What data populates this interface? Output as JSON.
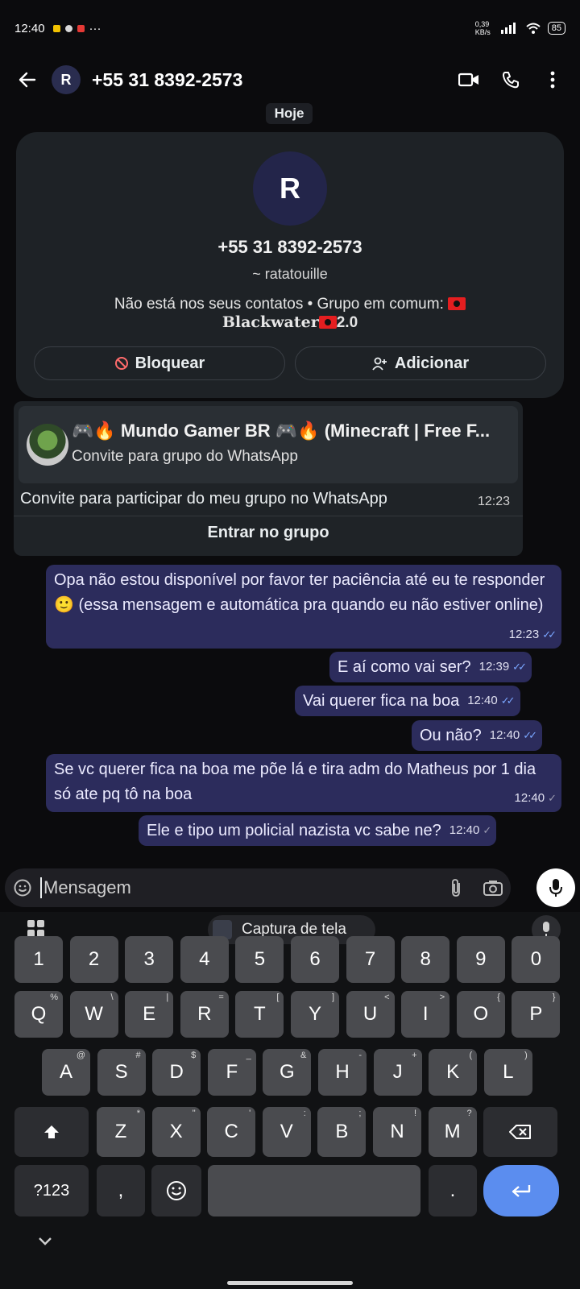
{
  "status": {
    "time": "12:40",
    "net_speed": "0,39 KB/s",
    "battery": "85"
  },
  "header": {
    "avatar_letter": "R",
    "title": "+55 31 8392-2573"
  },
  "chat": {
    "date_chip": "Hoje",
    "contact_card": {
      "avatar_letter": "R",
      "phone": "+55 31 8392-2573",
      "name": "~ ratatouille",
      "info_prefix": "Não está nos seus contatos  •  Grupo em comum: ",
      "group_name_a": "Blackwater",
      "group_name_b": "2.0",
      "block_label": "Bloquear",
      "add_label": "Adicionar"
    },
    "invite": {
      "title": "🎮🔥 Mundo Gamer BR 🎮🔥 (Minecraft | Free F...",
      "subtitle": "Convite para grupo do WhatsApp",
      "text": "Convite para participar do meu grupo no WhatsApp",
      "time": "12:23",
      "join_label": "Entrar no grupo"
    },
    "messages": [
      {
        "text": "Opa não estou disponível por favor ter paciência até eu te responder 🙂 (essa mensagem e automática pra quando eu não estiver online)",
        "time": "12:23",
        "status": "read"
      },
      {
        "text": "E aí como vai ser?",
        "time": "12:39",
        "status": "read"
      },
      {
        "text": "Vai querer fica na boa",
        "time": "12:40",
        "status": "read"
      },
      {
        "text": "Ou não?",
        "time": "12:40",
        "status": "read"
      },
      {
        "text": "Se vc querer fica na boa me põe lá e tira adm do Matheus por 1 dia só ate pq tô na boa",
        "time": "12:40",
        "status": "sent"
      },
      {
        "text": "Ele e tipo um policial nazista vc sabe ne?",
        "time": "12:40",
        "status": "sent"
      }
    ]
  },
  "input": {
    "placeholder": "Mensagem"
  },
  "keyboard": {
    "clipboard_label": "Captura de tela",
    "row_numbers": [
      "1",
      "2",
      "3",
      "4",
      "5",
      "6",
      "7",
      "8",
      "9",
      "0"
    ],
    "row1": [
      "Q",
      "W",
      "E",
      "R",
      "T",
      "Y",
      "U",
      "I",
      "O",
      "P"
    ],
    "row1_sup": [
      "%",
      "\\",
      "|",
      "=",
      "[",
      "]",
      "<",
      ">",
      "{",
      "}"
    ],
    "row2": [
      "A",
      "S",
      "D",
      "F",
      "G",
      "H",
      "J",
      "K",
      "L"
    ],
    "row2_sup": [
      "@",
      "#",
      "$",
      "_",
      "&",
      "-",
      "+",
      "(",
      ")"
    ],
    "row3": [
      "Z",
      "X",
      "C",
      "V",
      "B",
      "N",
      "M"
    ],
    "row3_sup": [
      "*",
      "\"",
      "'",
      ":",
      ";",
      "!",
      "?"
    ],
    "symbols_label": "?123",
    "comma": ",",
    "period": "."
  }
}
